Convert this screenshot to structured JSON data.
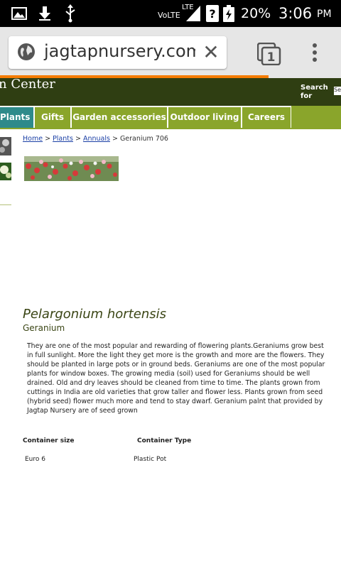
{
  "status_bar": {
    "network": "VoLTE",
    "lte": "LTE",
    "battery": "20%",
    "time": "3:06",
    "ampm": "PM"
  },
  "browser": {
    "url": "jagtapnursery.com",
    "tab_count": "1"
  },
  "site": {
    "brand_fragment": "n Center",
    "search_label_1": "Search",
    "search_label_2": "for",
    "search_box_value": "Se"
  },
  "nav": {
    "items": [
      {
        "label": "Plants"
      },
      {
        "label": "Gifts"
      },
      {
        "label": "Garden accessories"
      },
      {
        "label": "Outdoor living"
      },
      {
        "label": "Careers"
      }
    ]
  },
  "breadcrumb": {
    "home": "Home",
    "sep1": " > ",
    "plants": "Plants",
    "sep2": " > ",
    "annuals": "Annuals",
    "sep3": " > ",
    "current": "Geranium 706"
  },
  "product": {
    "botanical_name": "Pelargonium hortensis",
    "common_name": "Geranium",
    "description": "They are one of the most popular and rewarding of flowering plants.Geraniums grow best in full sunlight. More the light they get more is the growth and more are the flowers. They should be planted in large pots or in ground beds. Geraniums are one of the most popular plants for window boxes. The growing media (soil) used for Geraniums should be well drained. Old and dry leaves should be cleaned from time to time. The plants grown from cuttings in India are old varieties that grow taller and flower less. Plants grown from seed (hybrid seed) flower much more and tend to stay dwarf. Geranium palnt that provided by Jagtap Nursery are of seed grown",
    "specs": {
      "header_size": "Container size",
      "header_type": "Container Type",
      "size": "Euro 6",
      "type": "Plastic Pot"
    }
  },
  "colors": {
    "header_bg": "#2f3e12",
    "nav_green": "#8aa52b",
    "nav_active": "#2e8a8a",
    "progress": "#f57c00",
    "link": "#1a3fa5"
  }
}
